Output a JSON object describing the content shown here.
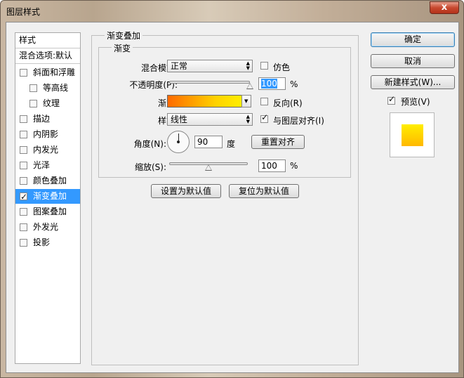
{
  "window": {
    "title": "图层样式",
    "close_glyph": "x"
  },
  "sidebar": {
    "head_label": "样式",
    "blend_label": "混合选项:默认",
    "items": [
      {
        "label": "斜面和浮雕",
        "checked": false
      },
      {
        "label": "等高线",
        "checked": false
      },
      {
        "label": "纹理",
        "checked": false
      },
      {
        "label": "描边",
        "checked": false
      },
      {
        "label": "内阴影",
        "checked": false
      },
      {
        "label": "内发光",
        "checked": false
      },
      {
        "label": "光泽",
        "checked": false
      },
      {
        "label": "颜色叠加",
        "checked": false
      },
      {
        "label": "渐变叠加",
        "checked": true
      },
      {
        "label": "图案叠加",
        "checked": false
      },
      {
        "label": "外发光",
        "checked": false
      },
      {
        "label": "投影",
        "checked": false
      }
    ]
  },
  "panel": {
    "title": "渐变叠加",
    "group_title": "渐变",
    "blend_mode_label": "混合模式:",
    "blend_mode_value": "正常",
    "dither_label": "仿色",
    "dither_checked": false,
    "opacity_label": "不透明度(P):",
    "opacity_value": "100",
    "opacity_level": 1.0,
    "opacity_unit": "%",
    "gradient_label": "渐变:",
    "gradient_colors": [
      "#ff6a00",
      "#ffd200",
      "#ffee00"
    ],
    "reverse_label": "反向(R)",
    "reverse_checked": false,
    "style_label": "样式:",
    "style_value": "线性",
    "align_label": "与图层对齐(I)",
    "align_checked": true,
    "angle_label": "角度(N):",
    "angle_value": "90",
    "angle_unit": "度",
    "reset_align_button": "重置对齐",
    "scale_label": "缩放(S):",
    "scale_value": "100",
    "scale_level": 0.5,
    "scale_unit": "%",
    "set_default_button": "设置为默认值",
    "reset_default_button": "复位为默认值"
  },
  "actions": {
    "ok": "确定",
    "cancel": "取消",
    "new_style": "新建样式(W)...",
    "preview_label": "预览(V)",
    "preview_checked": true
  },
  "colors": {
    "selection": "#3399ff",
    "swatch_top": "#ffee00",
    "swatch_bottom": "#ffb800"
  }
}
